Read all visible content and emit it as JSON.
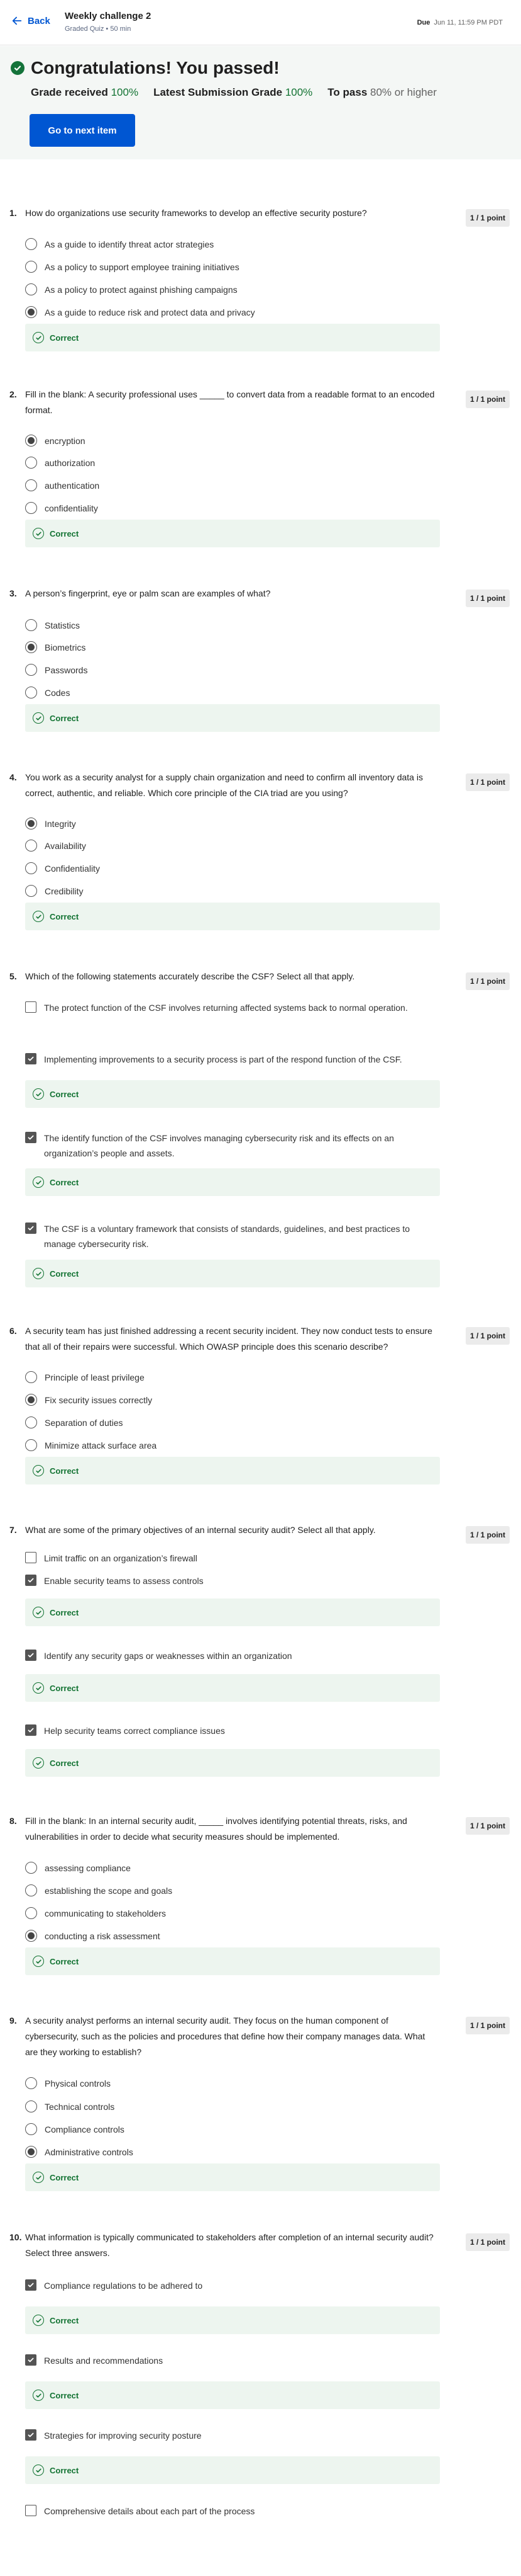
{
  "header": {
    "back_label": "Back",
    "title": "Weekly challenge 2",
    "subtitle": "Graded Quiz • 50 min",
    "due_label": "Due",
    "due_value": "Jun 11, 11:59 PM PDT"
  },
  "result": {
    "title": "Congratulations! You passed!",
    "grade_received_label": "Grade received",
    "grade_received_value": "100%",
    "latest_label": "Latest Submission Grade",
    "latest_value": "100%",
    "to_pass_label": "To pass",
    "to_pass_value": "80% or higher",
    "next_button": "Go to next item",
    "colors": {
      "accent": "#0056d2",
      "pass": "#137333",
      "banner_bg": "#f4f7f5"
    }
  },
  "feedback_label": "Correct",
  "points_label": "1 / 1 point",
  "questions": [
    {
      "number": "1.",
      "text": "How do organizations use security frameworks to develop an effective security posture?",
      "options": [
        "As a guide to identify threat actor strategies",
        "As a policy to support employee training initiatives",
        "As a policy to protect against phishing campaigns",
        "As a guide to reduce risk and protect data and privacy"
      ]
    },
    {
      "number": "2.",
      "text": "Fill in the blank: A security professional uses _____ to convert data from a readable format to an encoded format.",
      "options": [
        "encryption",
        "authorization",
        "authentication",
        "confidentiality"
      ]
    },
    {
      "number": "3.",
      "text": "A person’s fingerprint, eye or palm scan are examples of what?",
      "options": [
        "Statistics",
        "Biometrics",
        "Passwords",
        "Codes"
      ]
    },
    {
      "number": "4.",
      "text": "You work as a security analyst for a supply chain organization and need to confirm all inventory data is correct, authentic, and reliable. Which core principle of the CIA triad are you using?",
      "options": [
        "Integrity",
        "Availability",
        "Confidentiality",
        "Credibility"
      ]
    },
    {
      "number": "5.",
      "text": "Which of the following statements accurately describe the CSF? Select all that apply.",
      "options": [
        "The protect function of the CSF involves returning affected systems back to normal operation.",
        "Implementing improvements to a security process is part of the respond function of the CSF.",
        "The identify function of the CSF involves managing cybersecurity risk and its effects on an organization’s people and assets.",
        "The CSF is a voluntary framework that consists of standards, guidelines, and best practices to manage cybersecurity risk."
      ]
    },
    {
      "number": "6.",
      "text": "A security team has just finished addressing a recent security incident. They now conduct tests to ensure that all of their repairs were successful. Which OWASP principle does this scenario describe?",
      "options": [
        "Principle of least privilege",
        "Fix security issues correctly",
        "Separation of duties",
        "Minimize attack surface area"
      ]
    },
    {
      "number": "7.",
      "text": "What are some of the primary objectives of an internal security audit? Select all that apply.",
      "options": [
        "Limit traffic on an organization’s firewall",
        "Enable security teams to assess controls",
        "Identify any security gaps or weaknesses within an organization",
        "Help security teams correct compliance issues"
      ]
    },
    {
      "number": "8.",
      "text": "Fill in the blank: In an internal security audit, _____ involves identifying potential threats, risks, and vulnerabilities in order to decide what security measures should be implemented.",
      "options": [
        "assessing compliance",
        "establishing the scope and goals",
        "communicating to stakeholders",
        "conducting a risk assessment"
      ]
    },
    {
      "number": "9.",
      "text": "A security analyst performs an internal security audit. They focus on the human component of cybersecurity, such as the policies and procedures that define how their company manages data. What are they working to establish?",
      "options": [
        "Physical controls",
        "Technical controls",
        "Compliance controls",
        "Administrative controls"
      ]
    },
    {
      "number": "10.",
      "text": "What information is typically communicated to stakeholders after completion of an internal security audit? Select three answers.",
      "options": [
        "Compliance regulations to be adhered to",
        "Results and recommendations",
        "Strategies for improving security posture",
        "Comprehensive details about each part of the process"
      ]
    }
  ]
}
